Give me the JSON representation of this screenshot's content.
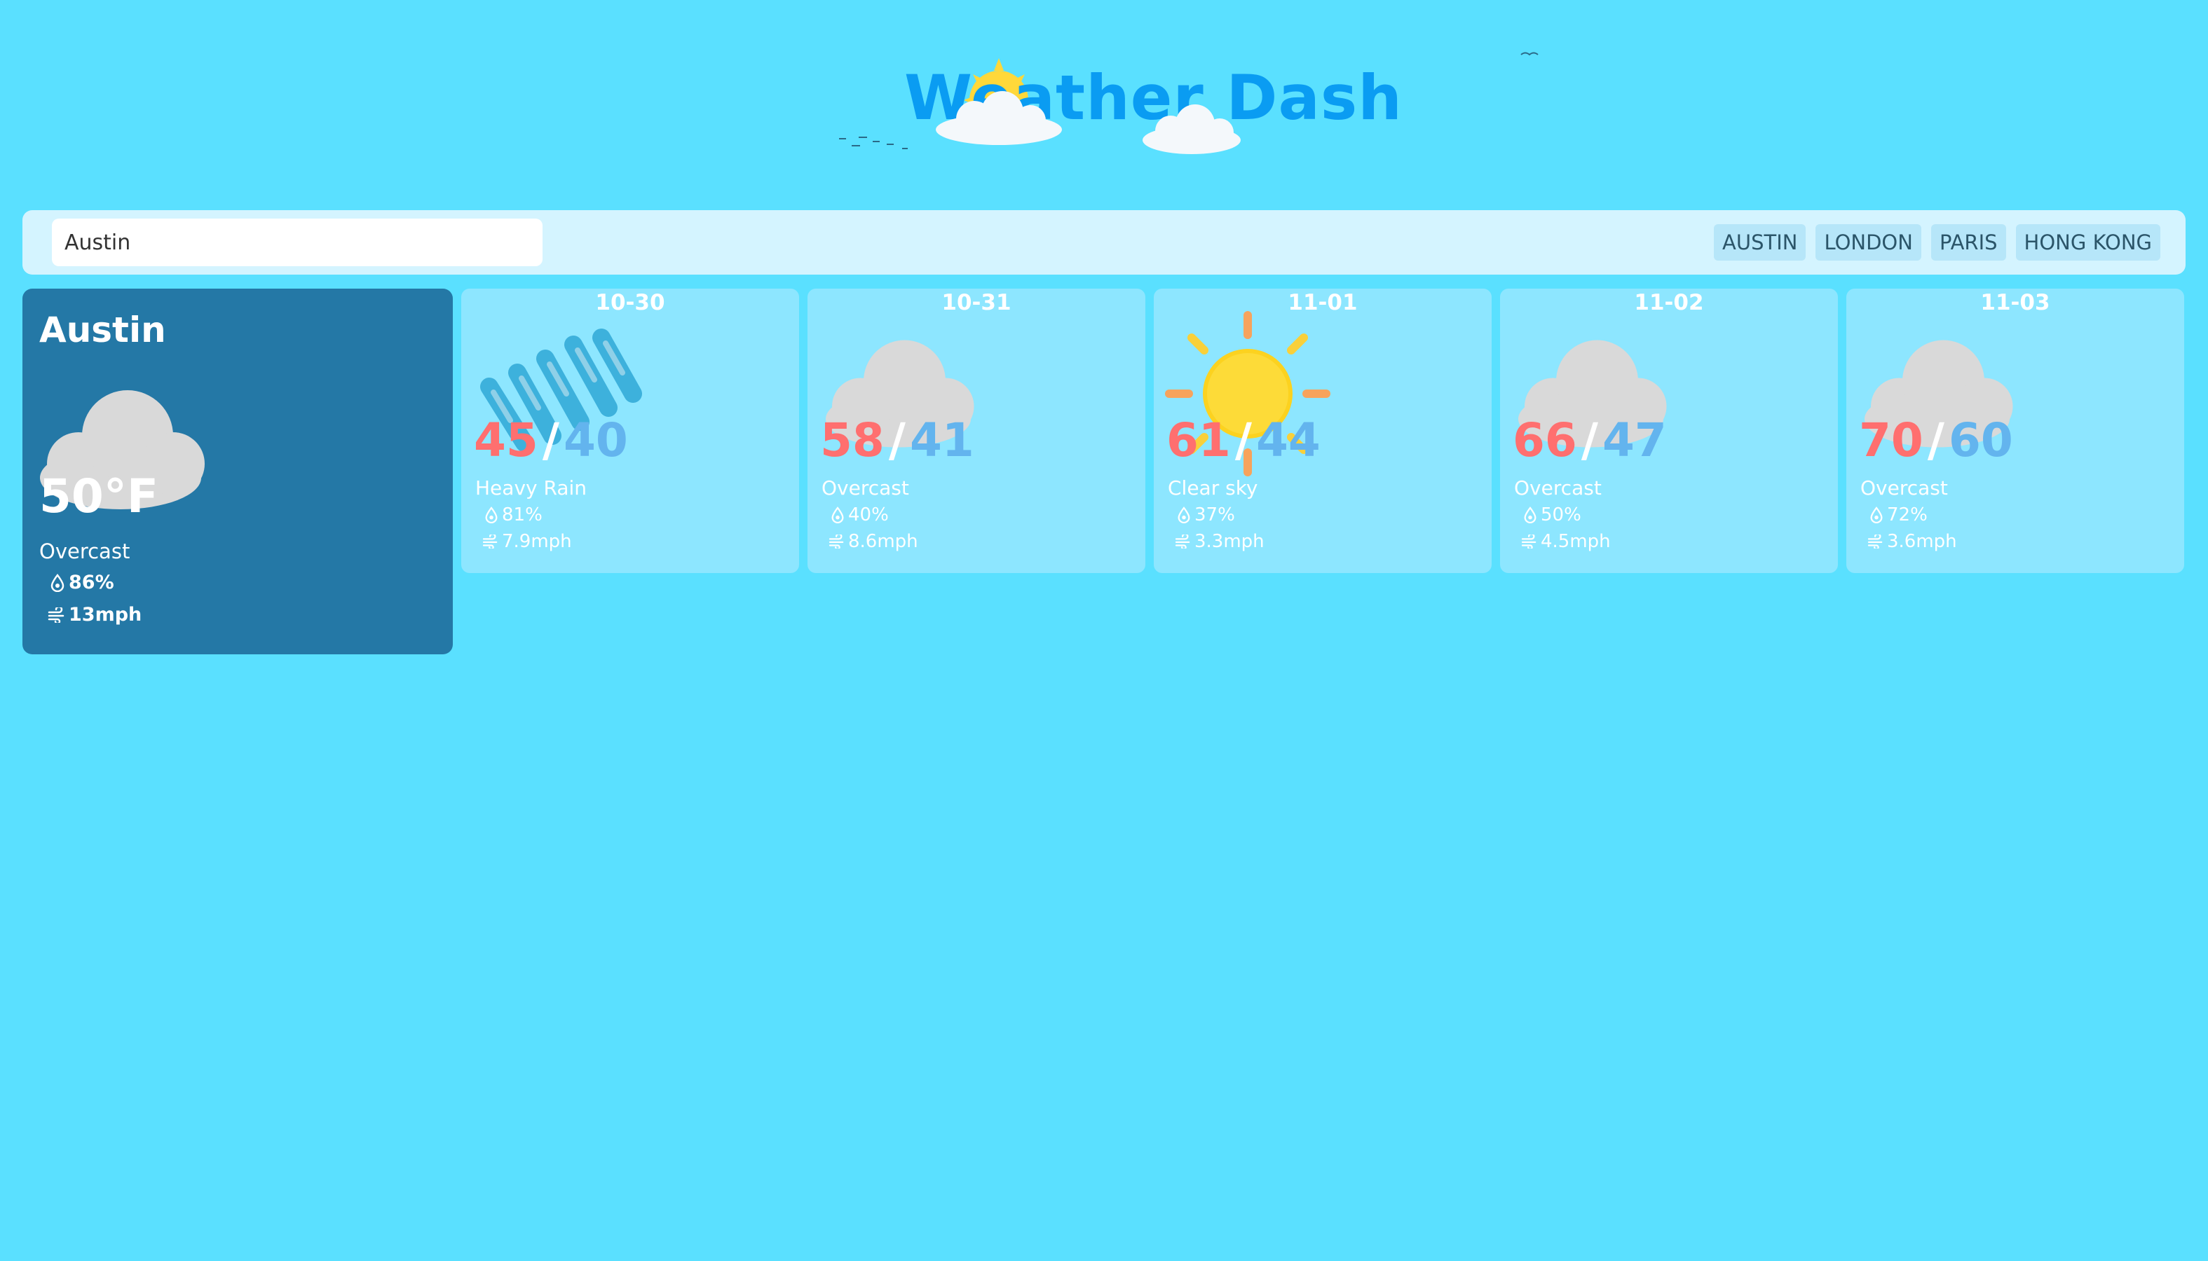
{
  "header": {
    "title": "Weather Dash"
  },
  "search": {
    "value": "Austin",
    "city_buttons": [
      "AUSTIN",
      "LONDON",
      "PARIS",
      "HONG KONG"
    ]
  },
  "current": {
    "city": "Austin",
    "temperature": "50°F",
    "condition": "Overcast",
    "humidity": "86%",
    "wind": "13mph",
    "icon": "cloud-icon"
  },
  "forecast": [
    {
      "date": "10-30",
      "high": "45",
      "low": "40",
      "condition": "Heavy Rain",
      "humidity": "81%",
      "wind": "7.9mph",
      "icon": "rain-icon"
    },
    {
      "date": "10-31",
      "high": "58",
      "low": "41",
      "condition": "Overcast",
      "humidity": "40%",
      "wind": "8.6mph",
      "icon": "cloud-icon"
    },
    {
      "date": "11-01",
      "high": "61",
      "low": "44",
      "condition": "Clear sky",
      "humidity": "37%",
      "wind": "3.3mph",
      "icon": "sun-icon"
    },
    {
      "date": "11-02",
      "high": "66",
      "low": "47",
      "condition": "Overcast",
      "humidity": "50%",
      "wind": "4.5mph",
      "icon": "cloud-icon"
    },
    {
      "date": "11-03",
      "high": "70",
      "low": "60",
      "condition": "Overcast",
      "humidity": "72%",
      "wind": "3.6mph",
      "icon": "cloud-icon"
    }
  ],
  "colors": {
    "background": "#5ae0ff",
    "current_card": "#2478a6",
    "forecast_card": "#8de6ff",
    "high_temp": "#ff6f6f",
    "low_temp": "#63b4ee",
    "title": "#0a9cf2"
  }
}
